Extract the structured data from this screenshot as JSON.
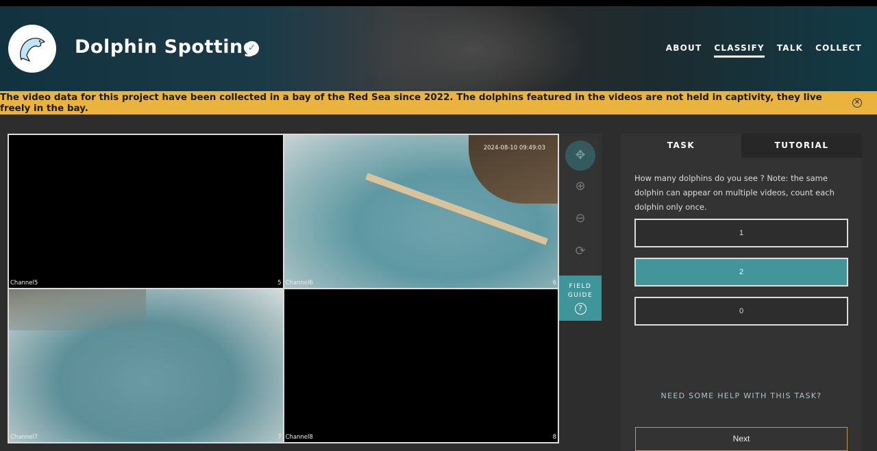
{
  "header": {
    "title": "Dolphin Spotting",
    "nav": [
      "ABOUT",
      "CLASSIFY",
      "TALK",
      "COLLECT"
    ],
    "active_nav": "CLASSIFY"
  },
  "banner": {
    "text": "The video data for this project have been collected in a bay of the Red Sea since 2022. The dolphins featured in the videos are not held in captivity, they live freely in the bay."
  },
  "viewer": {
    "cells": [
      {
        "label": "Channel5",
        "number": "5"
      },
      {
        "label": "Channel6",
        "number": "6",
        "timestamp": "2024-08-10 09:49:03"
      },
      {
        "label": "Channel7",
        "number": "7"
      },
      {
        "label": "Channel8",
        "number": "8"
      }
    ]
  },
  "tools": [
    "move-icon",
    "zoom-in-icon",
    "zoom-out-icon",
    "rotate-icon"
  ],
  "field_guide": {
    "line1": "FIELD",
    "line2": "GUIDE",
    "icon": "?"
  },
  "task": {
    "tabs": [
      "TASK",
      "TUTORIAL"
    ],
    "question": "How many dolphins do you see ? Note: the same dolphin can appear on multiple videos, count each dolphin only once.",
    "answers": [
      "1",
      "2",
      "0"
    ],
    "selected": "2",
    "help": "NEED SOME HELP WITH THIS TASK?",
    "next": "Next"
  },
  "colors": {
    "accent": "#42969a",
    "banner": "#e9b33e",
    "next_border": "#c59c3a"
  }
}
